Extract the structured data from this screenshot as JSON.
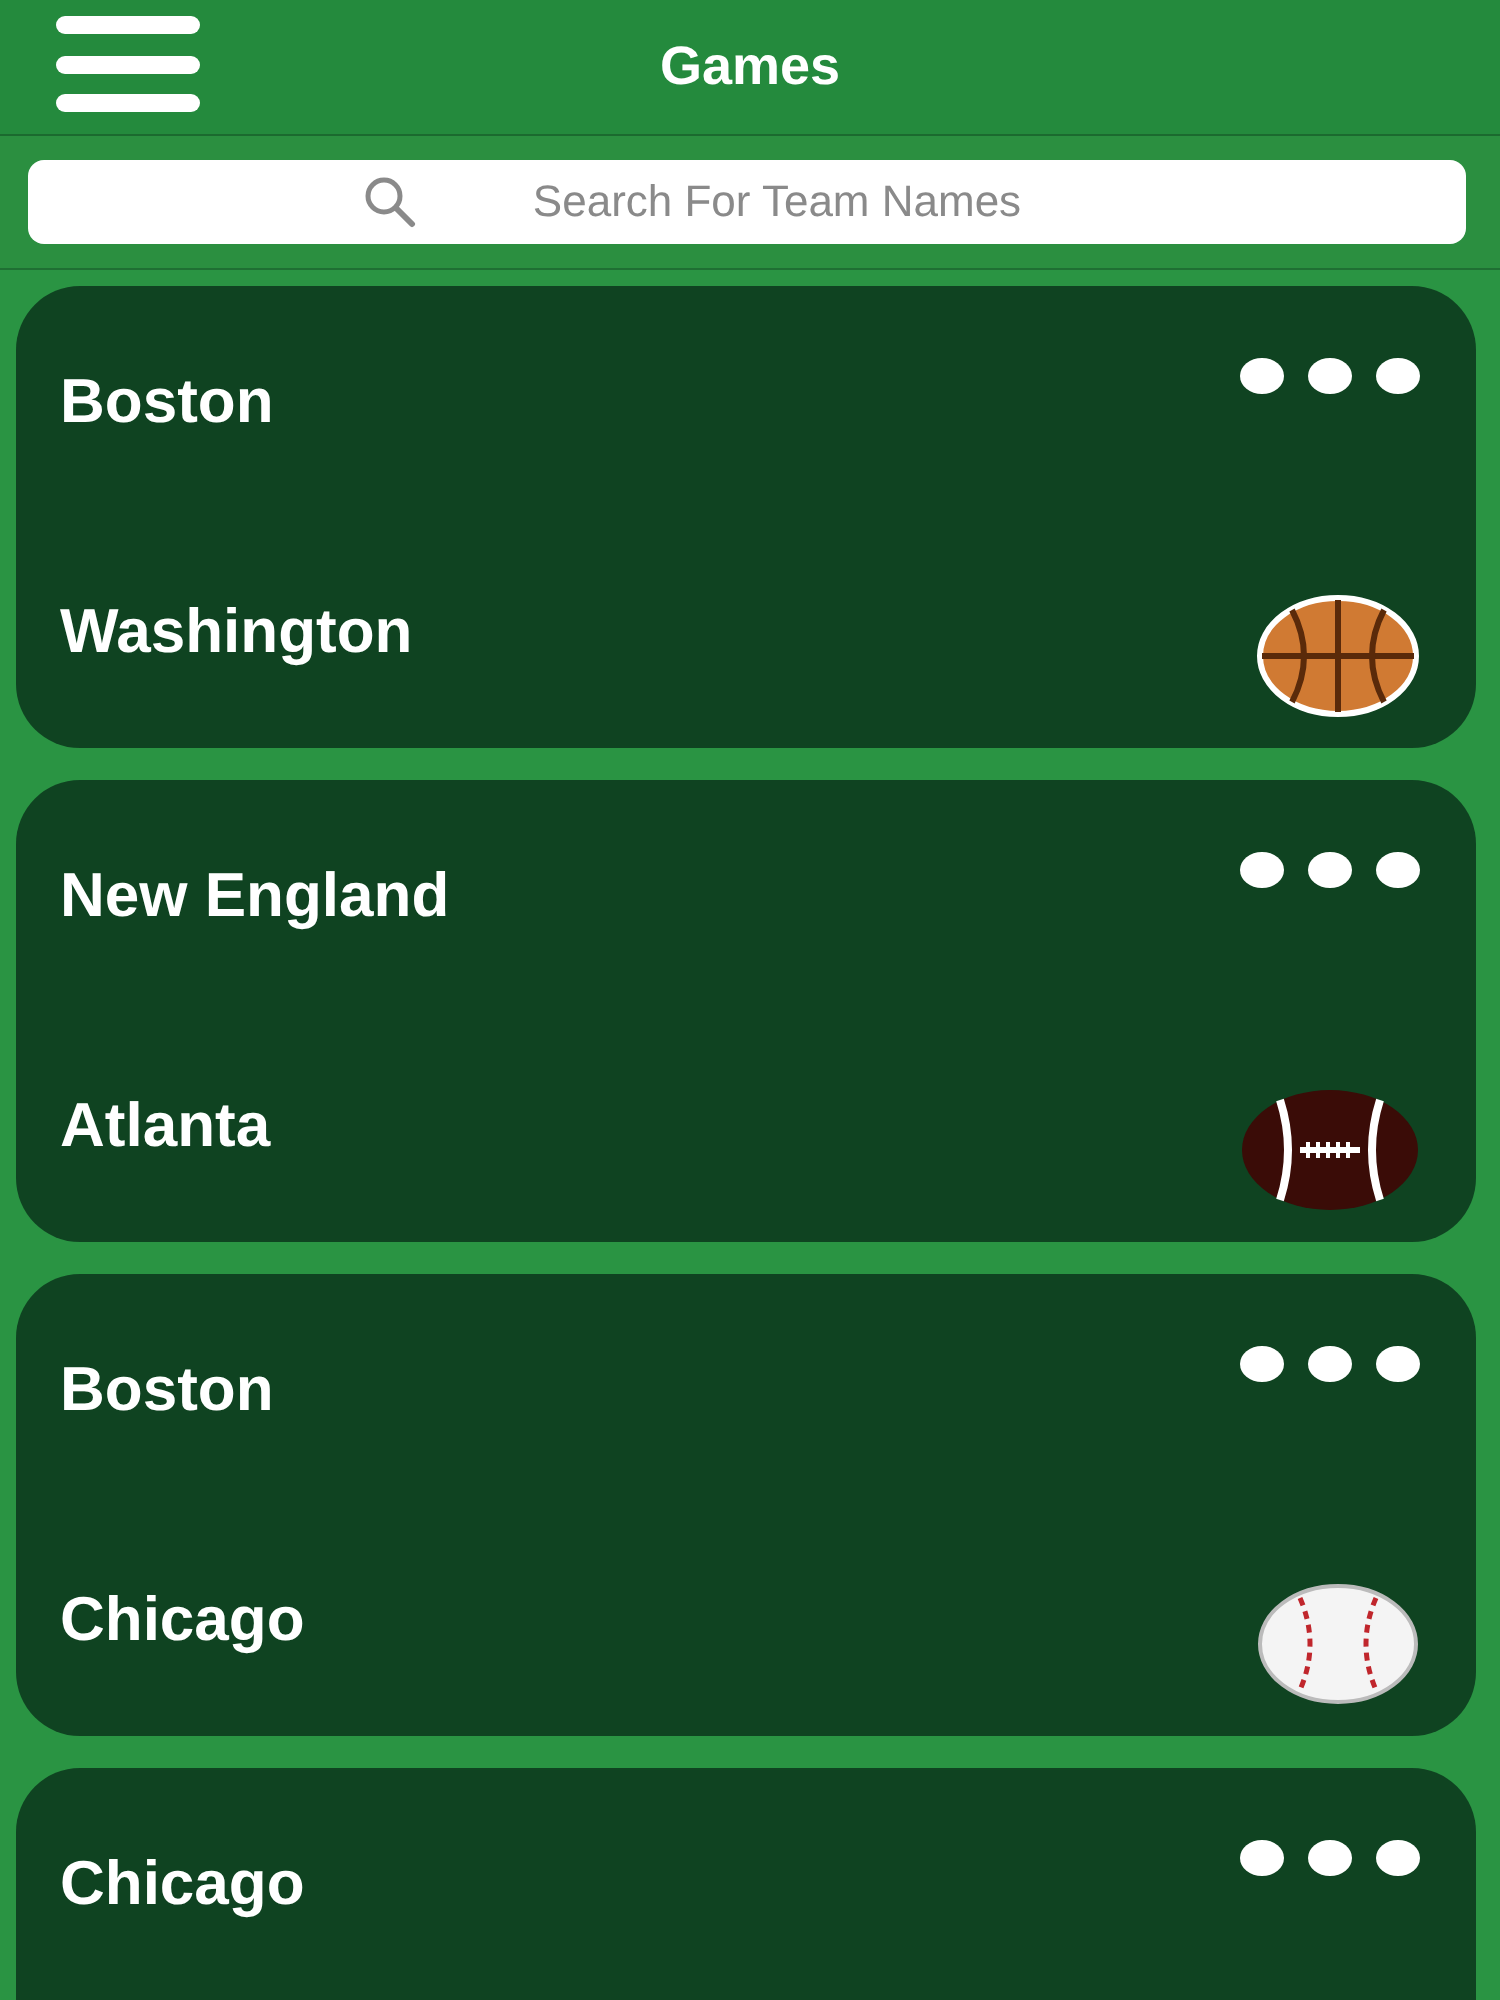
{
  "header": {
    "title": "Games"
  },
  "search": {
    "placeholder": "Search For Team Names"
  },
  "games": [
    {
      "kind": "basketball",
      "teams": [
        "Boston",
        "Washington"
      ]
    },
    {
      "kind": "football",
      "teams": [
        "New England",
        "Atlanta"
      ]
    },
    {
      "kind": "baseball",
      "teams": [
        "Boston",
        "Chicago"
      ]
    },
    {
      "teams": [
        "Chicago"
      ]
    }
  ]
}
